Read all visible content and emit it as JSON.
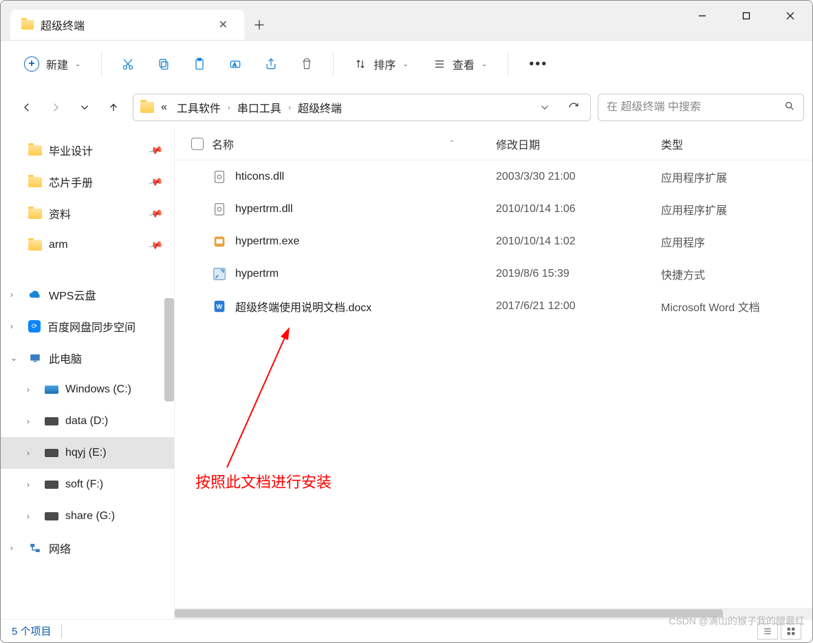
{
  "window": {
    "tab_title": "超级终端"
  },
  "toolbar": {
    "new_label": "新建",
    "sort_label": "排序",
    "view_label": "查看"
  },
  "breadcrumb": {
    "ellipsis": "«",
    "items": [
      "工具软件",
      "串口工具",
      "超级终端"
    ]
  },
  "search": {
    "placeholder": "在 超级终端 中搜索"
  },
  "sidebar": {
    "quick": [
      {
        "label": "毕业设计"
      },
      {
        "label": "芯片手册"
      },
      {
        "label": "资料"
      },
      {
        "label": "arm"
      }
    ],
    "cloud": [
      {
        "label": "WPS云盘",
        "icon": "wps"
      },
      {
        "label": "百度网盘同步空间",
        "icon": "baidu"
      }
    ],
    "thispc_label": "此电脑",
    "drives": [
      {
        "label": "Windows (C:)",
        "kind": "c"
      },
      {
        "label": "data (D:)",
        "kind": "d"
      },
      {
        "label": "hqyj (E:)",
        "kind": "d",
        "selected": true
      },
      {
        "label": "soft (F:)",
        "kind": "d"
      },
      {
        "label": "share (G:)",
        "kind": "d"
      }
    ],
    "network_label": "网络"
  },
  "columns": {
    "name": "名称",
    "date": "修改日期",
    "type": "类型"
  },
  "files": [
    {
      "icon": "dll",
      "name": "hticons.dll",
      "date": "2003/3/30 21:00",
      "type": "应用程序扩展"
    },
    {
      "icon": "dll",
      "name": "hypertrm.dll",
      "date": "2010/10/14 1:06",
      "type": "应用程序扩展"
    },
    {
      "icon": "exe",
      "name": "hypertrm.exe",
      "date": "2010/10/14 1:02",
      "type": "应用程序"
    },
    {
      "icon": "lnk",
      "name": "hypertrm",
      "date": "2019/8/6 15:39",
      "type": "快捷方式"
    },
    {
      "icon": "docx",
      "name": "超级终端使用说明文档.docx",
      "date": "2017/6/21 12:00",
      "type": "Microsoft Word 文档"
    }
  ],
  "annotation": "按照此文档进行安装",
  "status": {
    "count": "5 个项目"
  },
  "watermark": "CSDN @满山的猴子我的腿最红"
}
